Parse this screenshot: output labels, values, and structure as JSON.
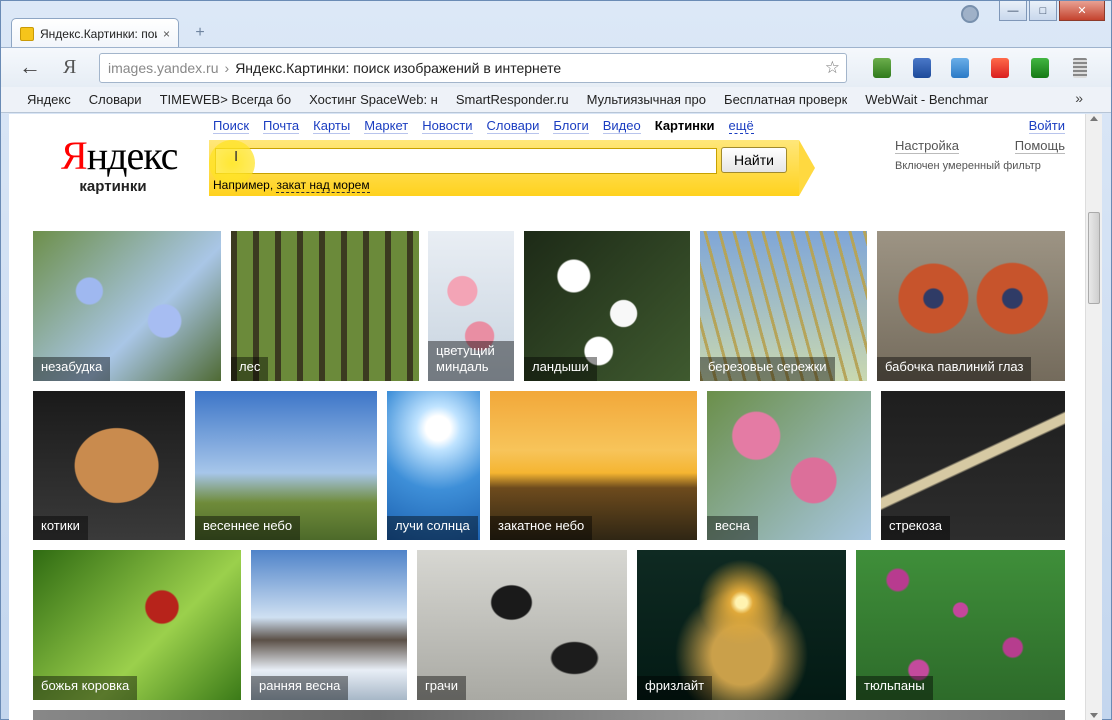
{
  "browser": {
    "tab_title": "Яндекс.Картинки: пои",
    "tab_close": "×",
    "new_tab": "+",
    "url_domain": "images.yandex.ru",
    "url_separator": "›",
    "url_title": "Яндекс.Картинки: поиск изображений в интернете",
    "back": "←",
    "ya_button": "Я",
    "star": "☆",
    "bookmarks": [
      "Яндекс",
      "Словари",
      "TIMEWEB> Всегда бо",
      "Хостинг SpaceWeb: н",
      "SmartResponder.ru",
      "Мультиязычная про",
      "Бесплатная проверк",
      "WebWait - Benchmar"
    ],
    "bookmarks_more": "»",
    "win_min": "—",
    "win_max": "□",
    "win_close": "✕"
  },
  "page": {
    "logo_first": "Я",
    "logo_rest": "ндекс",
    "logo_sub": "картинки",
    "services": [
      "Поиск",
      "Почта",
      "Карты",
      "Маркет",
      "Новости",
      "Словари",
      "Блоги",
      "Видео"
    ],
    "service_active": "Картинки",
    "service_more": "ещё",
    "search_button": "Найти",
    "example_prefix": "Например, ",
    "example_link": "закат над морем",
    "login": "Войти",
    "settings": "Настройка",
    "help": "Помощь",
    "filter_note": "Включен умеренный фильтр"
  },
  "tiles": [
    {
      "label": "незабудка",
      "bg": "radial-gradient(circle at 30% 40%, #9fb8f0 0 8%, transparent 9%), radial-gradient(circle at 70% 60%, #a7bdf2 0 10%, transparent 11%), linear-gradient(135deg, #6d8f4a, #a9c6e6 60%, #4f6a34)"
    },
    {
      "label": "лес",
      "bg": "repeating-linear-gradient(90deg, #3b3a20 0 6px, #6b8a3a 6px 22px), linear-gradient(#8db25a, #4d5c2a)"
    },
    {
      "label": "цветущий миндаль",
      "bg": "radial-gradient(circle at 40% 40%, #f3a4b6 0 14%, transparent 15%), radial-gradient(circle at 60% 70%, #e98ea3 0 12%, transparent 13%), linear-gradient(#e9eef4, #c7d3df)"
    },
    {
      "label": "ландыши",
      "bg": "radial-gradient(circle at 30% 30%, #fff 0 10%, transparent 11%), radial-gradient(circle at 60% 55%, #f8f8f8 0 10%, transparent 11%), radial-gradient(circle at 45% 80%, #fff 0 9%, transparent 10%), linear-gradient(135deg, #1d2a17, #3f5a2f)"
    },
    {
      "label": "березовые сережки",
      "bg": "repeating-linear-gradient(75deg, #b5a45a 0 3px, transparent 3px 14px), linear-gradient(#7fa6d8, #c9d8b0)"
    },
    {
      "label": "бабочка павлиний глаз",
      "bg": "radial-gradient(circle at 30% 45%, #2f3b66 0 6%, #c7542c 7% 22%, transparent 23%), radial-gradient(circle at 72% 45%, #2f3b66 0 6%, #c7542c 7% 22%, transparent 23%), linear-gradient(#9d9484, #746b5c)"
    },
    {
      "label": "котики",
      "bg": "radial-gradient(ellipse at 55% 50%, #c98b4e 0 35%, transparent 36%), linear-gradient(#1a1a1a, #3a3a3a)"
    },
    {
      "label": "весеннее небо",
      "bg": "linear-gradient(#3d76c8 0%, #a7c6ea 55%, #6f8b3a 75%, #4d6a2a 100%)"
    },
    {
      "label": "лучи солнца",
      "bg": "radial-gradient(circle at 55% 25%, #ffffff 0 10%, #bfe3ff 18%, #3e8fd8 50%, #1b5fae 100%)"
    },
    {
      "label": "закатное небо",
      "bg": "linear-gradient(#f2a83a 0%, #f7c45a 40%, #f5b531 55%, #6e4b1d 65%, #2f2614 100%)"
    },
    {
      "label": "весна",
      "bg": "radial-gradient(circle at 30% 30%, #e47ba4 0 15%, transparent 16%), radial-gradient(circle at 65% 60%, #dc6f9a 0 16%, transparent 17%), linear-gradient(135deg, #6b8f4a, #a7c6e0)"
    },
    {
      "label": "стрекоза",
      "bg": "linear-gradient(155deg, transparent 45%, #d6c9a3 46% 50%, transparent 51%), linear-gradient(#1e1e1e, #2d2d2d)"
    },
    {
      "label": "божья коровка",
      "bg": "radial-gradient(circle at 62% 38%, #b7231b 0 10%, transparent 11%), linear-gradient(135deg, #2f6b12, #9bd04c 60%, #3b7a18)"
    },
    {
      "label": "ранняя весна",
      "bg": "linear-gradient(#4f83c9 0%, #cfe0f2 45%, #5b5047 60%, #e8eef6 80%, #a7b7c7 100%)"
    },
    {
      "label": "грачи",
      "bg": "radial-gradient(ellipse at 45% 35%, #1a1a1a 0 12%, transparent 13%), radial-gradient(ellipse at 75% 72%, #1c1c1c 0 10%, transparent 11%), linear-gradient(#d7d7d2, #a9a9a3)"
    },
    {
      "label": "фризлайт",
      "bg": "radial-gradient(circle at 50% 35%, #fff3b0 0 4%, #e0a93a 8%, transparent 30%), radial-gradient(ellipse at 50% 70%, #caa04a 0 20%, transparent 45%), linear-gradient(#0f2a22, #031a14)"
    },
    {
      "label": "тюльпаны",
      "bg": "radial-gradient(circle at 20% 20%, #b83b8f 0 5%, transparent 6%), radial-gradient(circle at 50% 40%, #c4469c 0 5%, transparent 6%), radial-gradient(circle at 75% 65%, #b63d8e 0 5%, transparent 6%), radial-gradient(circle at 30% 80%, #c44a9d 0 5%, transparent 6%), linear-gradient(#3f8f3a, #2d6b2a)"
    }
  ]
}
